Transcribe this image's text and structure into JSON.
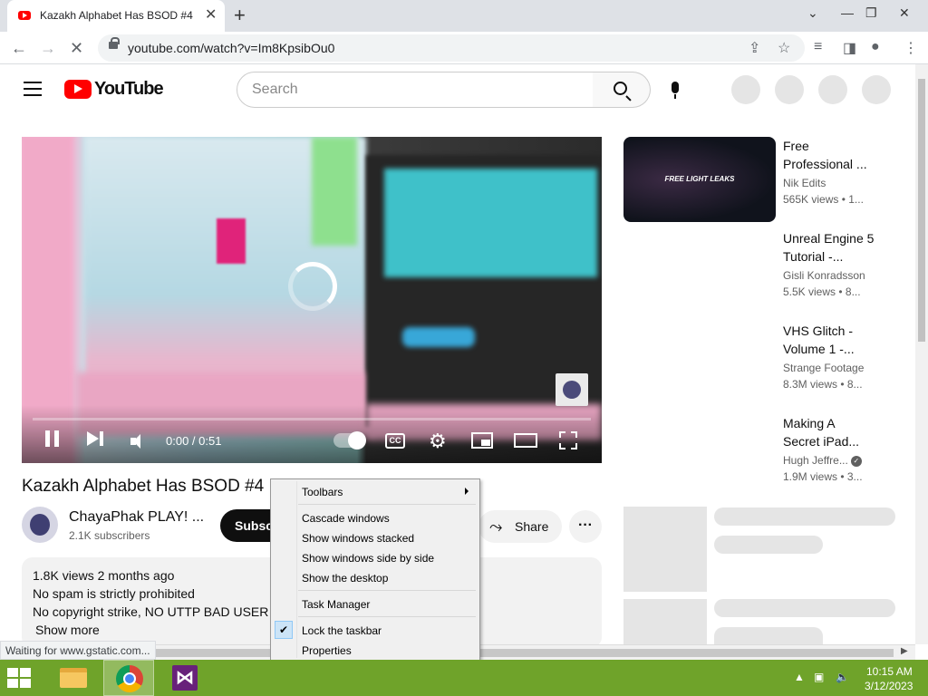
{
  "browser": {
    "tab_title": "Kazakh Alphabet Has BSOD #4 -",
    "url": "youtube.com/watch?v=Im8KpsibOu0",
    "status_text": "Waiting for www.gstatic.com..."
  },
  "youtube": {
    "wordmark": "YouTube",
    "search_placeholder": "Search"
  },
  "player": {
    "time": "0:00 / 0:51",
    "progress_fraction": 0.0,
    "cc_label": "CC"
  },
  "video": {
    "title": "Kazakh Alphabet Has BSOD #4",
    "channel_name": "ChayaPhak PLAY! ...",
    "subscribers": "2.1K subscribers",
    "subscribe_label": "Subsc",
    "share_label": "Share",
    "description": {
      "stats": "1.8K views  2 months ago",
      "line1": "No spam is strictly prohibited",
      "line2": "No copyright strike, NO UTTP BAD USER A",
      "show_more": "Show more"
    }
  },
  "recommendations": [
    {
      "title_line1": "Free",
      "title_line2": "Professional ...",
      "channel": "Nik Edits",
      "meta": "565K views  • 1...",
      "thumb_text": "FREE LIGHT LEAKS"
    },
    {
      "title_line1": "Unreal Engine 5",
      "title_line2": "Tutorial -...",
      "channel": "Gisli Konradsson",
      "meta": "5.5K views  • 8..."
    },
    {
      "title_line1": "VHS Glitch -",
      "title_line2": "Volume 1 -...",
      "channel": "Strange Footage",
      "meta": "8.3M views  • 8..."
    },
    {
      "title_line1": "Making A",
      "title_line2": "Secret iPad...",
      "channel": "Hugh Jeffre...",
      "meta": "1.9M views  • 3...",
      "verified": true
    }
  ],
  "context_menu": {
    "items": [
      "Toolbars",
      "Cascade windows",
      "Show windows stacked",
      "Show windows side by side",
      "Show the desktop",
      "Task Manager",
      "Lock the taskbar",
      "Properties"
    ],
    "checked": "Lock the taskbar"
  },
  "taskbar": {
    "time": "10:15 AM",
    "date": "3/12/2023",
    "apps": [
      "file-explorer",
      "chrome",
      "visual-studio"
    ]
  },
  "colors": {
    "youtube_red": "#ff0000",
    "taskbar_green": "#6fa32a",
    "visual_studio_purple": "#68217a"
  }
}
